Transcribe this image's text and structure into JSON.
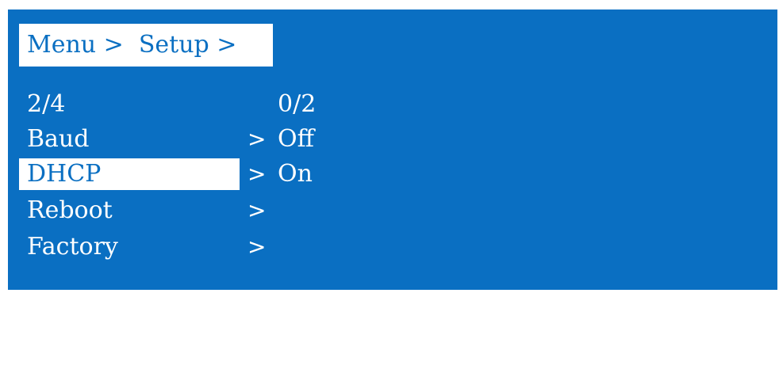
{
  "colors": {
    "screen_background": "#0a6fc2",
    "text": "#ffffff",
    "highlight": "#ffffff"
  },
  "breadcrumb": {
    "text": "Menu >  Setup >"
  },
  "menu": {
    "page_indicator": "2/4",
    "items": [
      {
        "label": "Baud",
        "chevron": ">"
      },
      {
        "label": "DHCP",
        "chevron": ">",
        "selected": true
      },
      {
        "label": "Reboot",
        "chevron": ">"
      },
      {
        "label": "Factory",
        "chevron": ">"
      }
    ]
  },
  "submenu": {
    "page_indicator": "0/2",
    "options": [
      "Off",
      "On"
    ]
  }
}
